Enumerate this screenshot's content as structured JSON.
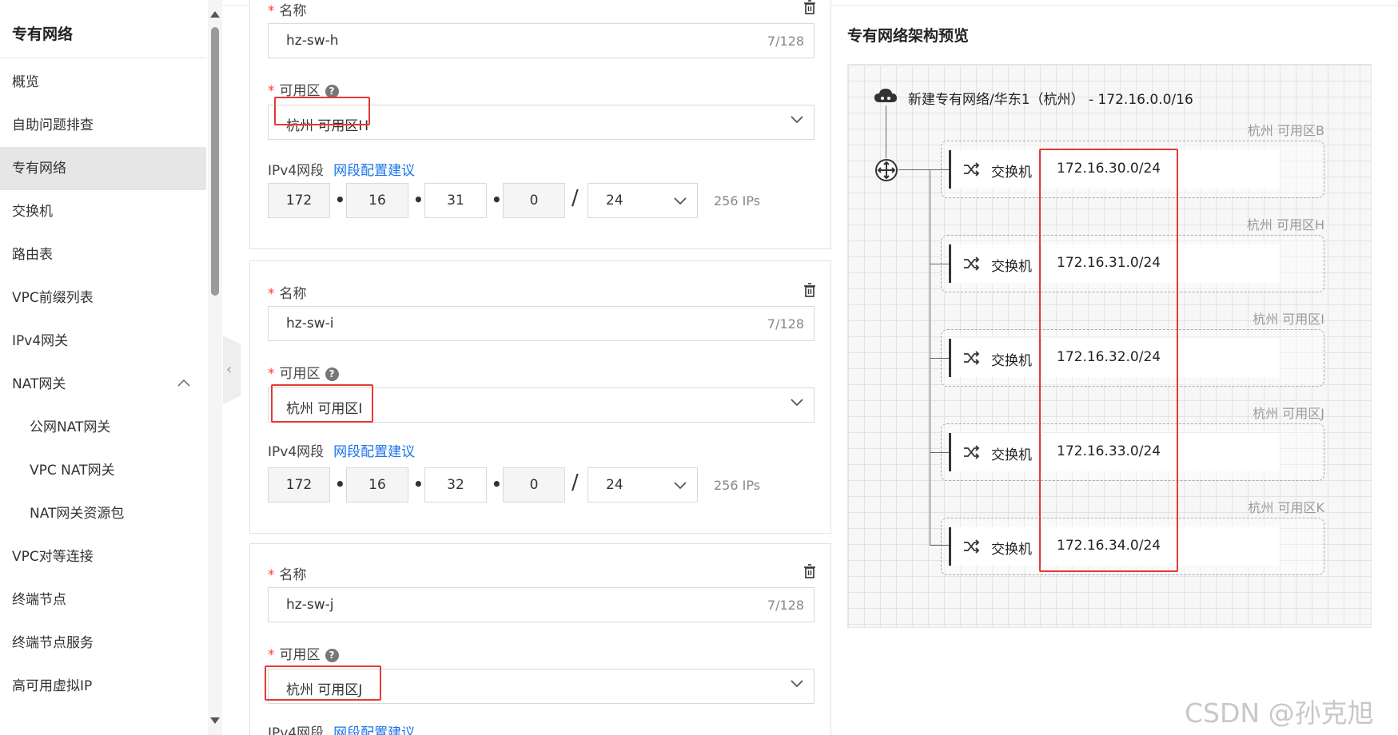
{
  "sidebar": {
    "title": "专有网络",
    "items": [
      {
        "label": "概览"
      },
      {
        "label": "自助问题排查"
      },
      {
        "label": "专有网络"
      },
      {
        "label": "交换机"
      },
      {
        "label": "路由表"
      },
      {
        "label": "VPC前缀列表"
      },
      {
        "label": "IPv4网关"
      },
      {
        "label": "NAT网关"
      },
      {
        "label": "公网NAT网关"
      },
      {
        "label": "VPC NAT网关"
      },
      {
        "label": "NAT网关资源包"
      },
      {
        "label": "VPC对等连接"
      },
      {
        "label": "终端节点"
      },
      {
        "label": "终端节点服务"
      },
      {
        "label": "高可用虚拟IP"
      }
    ]
  },
  "form": {
    "name_label": "名称",
    "zone_label": "可用区",
    "help_glyph": "?",
    "ipv4_label": "IPv4网段",
    "ipv4_link": "网段配置建议",
    "cards": [
      {
        "name": "hz-sw-h",
        "count": "7/128",
        "zone": "杭州 可用区H",
        "ip": [
          "172",
          "16",
          "31",
          "0"
        ],
        "mask": "24",
        "ips": "256 IPs"
      },
      {
        "name": "hz-sw-i",
        "count": "7/128",
        "zone": "杭州 可用区I",
        "ip": [
          "172",
          "16",
          "32",
          "0"
        ],
        "mask": "24",
        "ips": "256 IPs"
      },
      {
        "name": "hz-sw-j",
        "count": "7/128",
        "zone": "杭州 可用区J"
      }
    ],
    "dot": "•",
    "slash": "/"
  },
  "preview": {
    "title": "专有网络架构预览",
    "vpc": "新建专有网络/华东1（杭州） - 172.16.0.0/16",
    "zones": [
      {
        "zone": "杭州 可用区B",
        "switch": "交换机",
        "cidr": "172.16.30.0/24"
      },
      {
        "zone": "杭州 可用区H",
        "switch": "交换机",
        "cidr": "172.16.31.0/24"
      },
      {
        "zone": "杭州 可用区I",
        "switch": "交换机",
        "cidr": "172.16.32.0/24"
      },
      {
        "zone": "杭州 可用区J",
        "switch": "交换机",
        "cidr": "172.16.33.0/24"
      },
      {
        "zone": "杭州 可用区K",
        "switch": "交换机",
        "cidr": "172.16.34.0/24"
      }
    ]
  },
  "watermark": "CSDN @孙克旭",
  "colors": {
    "accent": "#ff6a00",
    "link": "#1a73e8",
    "highlight": "#e53935",
    "required": "#ff3b30"
  }
}
